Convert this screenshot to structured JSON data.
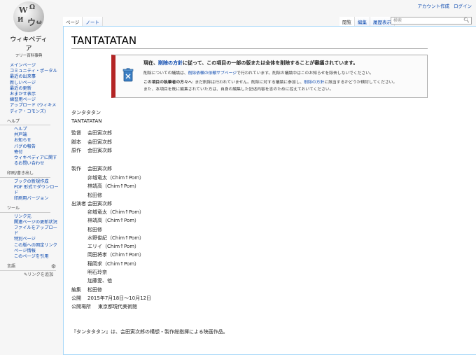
{
  "personal": {
    "create_account": "アカウント作成",
    "login": "ログイン"
  },
  "logo": {
    "title": "ウィキペディア",
    "subtitle": "フリー百科事典"
  },
  "sidebar": {
    "nav": [
      "メインページ",
      "コミュニティ・ポータル",
      "最近の出来事",
      "新しいページ",
      "最近の更新",
      "おまかせ表示",
      "練習用ページ",
      "アップロード (ウィキメディア・コモンズ)"
    ],
    "help_head": "ヘルプ",
    "help": [
      "ヘルプ",
      "井戸端",
      "お知らせ",
      "バグの報告",
      "寄付",
      "ウィキペディアに関するお問い合わせ"
    ],
    "print_head": "印刷/書き出し",
    "print": [
      "ブックの新規作成",
      "PDF 形式でダウンロード",
      "印刷用バージョン"
    ],
    "tools_head": "ツール",
    "tools": [
      "リンク元",
      "関連ページの更新状況",
      "ファイルをアップロード",
      "特別ページ",
      "この版への固定リンク",
      "ページ情報",
      "このページを引用"
    ],
    "lang_head": "言語",
    "add_link": "リンクを追加"
  },
  "tabs": {
    "page": "ページ",
    "talk": "ノート",
    "read": "閲覧",
    "edit": "編集",
    "history": "履歴表示"
  },
  "search": {
    "placeholder": "検索"
  },
  "article": {
    "title": "TANTATATAN",
    "notice": {
      "headline_pre": "現在、",
      "headline_link": "削除の方針",
      "headline_post": "に従って、この項目の一部の版または全体を削除することが審議されています。",
      "line1_pre": "削除についての議論は、",
      "line1_link": "削除依頼の依頼サブページ",
      "line1_post": "で行われています。削除の議論中はこのお知らせを除去しないでください。",
      "line2_bold": "この項目の執筆者の方々へ",
      "line2_mid": ": まだ削除は行われていません。削除に対する議論に参加し、",
      "line2_link": "削除の方針",
      "line2_post": "に該当するかどうか検討してください。",
      "line3": "また、本項目を既に編集されていた方は、自身の編集した記述内容を念のために控えておいてください。"
    },
    "lines": {
      "kana": "タンタタタン",
      "latin": "TANTATATAN",
      "director": [
        "監督",
        "会田寅次郎"
      ],
      "writer": [
        "脚本",
        "会田寅次郎"
      ],
      "original": [
        "原作",
        "会田寅次郎"
      ],
      "production": [
        "製作",
        "会田寅次郎"
      ],
      "production_more": [
        "卯城竜太（Chim↑Pom）",
        "林靖高（Chim↑Pom）",
        "松田修"
      ],
      "cast_label": "出演者",
      "cast_first": "会田寅次郎",
      "cast_more": [
        "卯城竜太（Chim↑Pom）",
        "林靖高（Chim↑Pom）",
        "松田修",
        "水野俊紀（Chim↑Pom）",
        "エリイ（Chim↑Pom）",
        "岡田将孝（Chim↑Pom）",
        "稲岡求（Chim↑Pom）",
        "明石玲奈",
        "加藤愛、他"
      ],
      "editing": [
        "編集",
        "松田修"
      ],
      "release": [
        "公開",
        "2015年7月18日〜10月12日"
      ],
      "venue": [
        "公開場所",
        "東京都現代美術館"
      ],
      "summary": "『タンタタタン』は、会田寅次郎の構想・製作総指揮による映画作品。"
    }
  },
  "colors": {
    "link": "#0645ad",
    "notice_bar": "#b32424",
    "border": "#a7d7f9"
  }
}
